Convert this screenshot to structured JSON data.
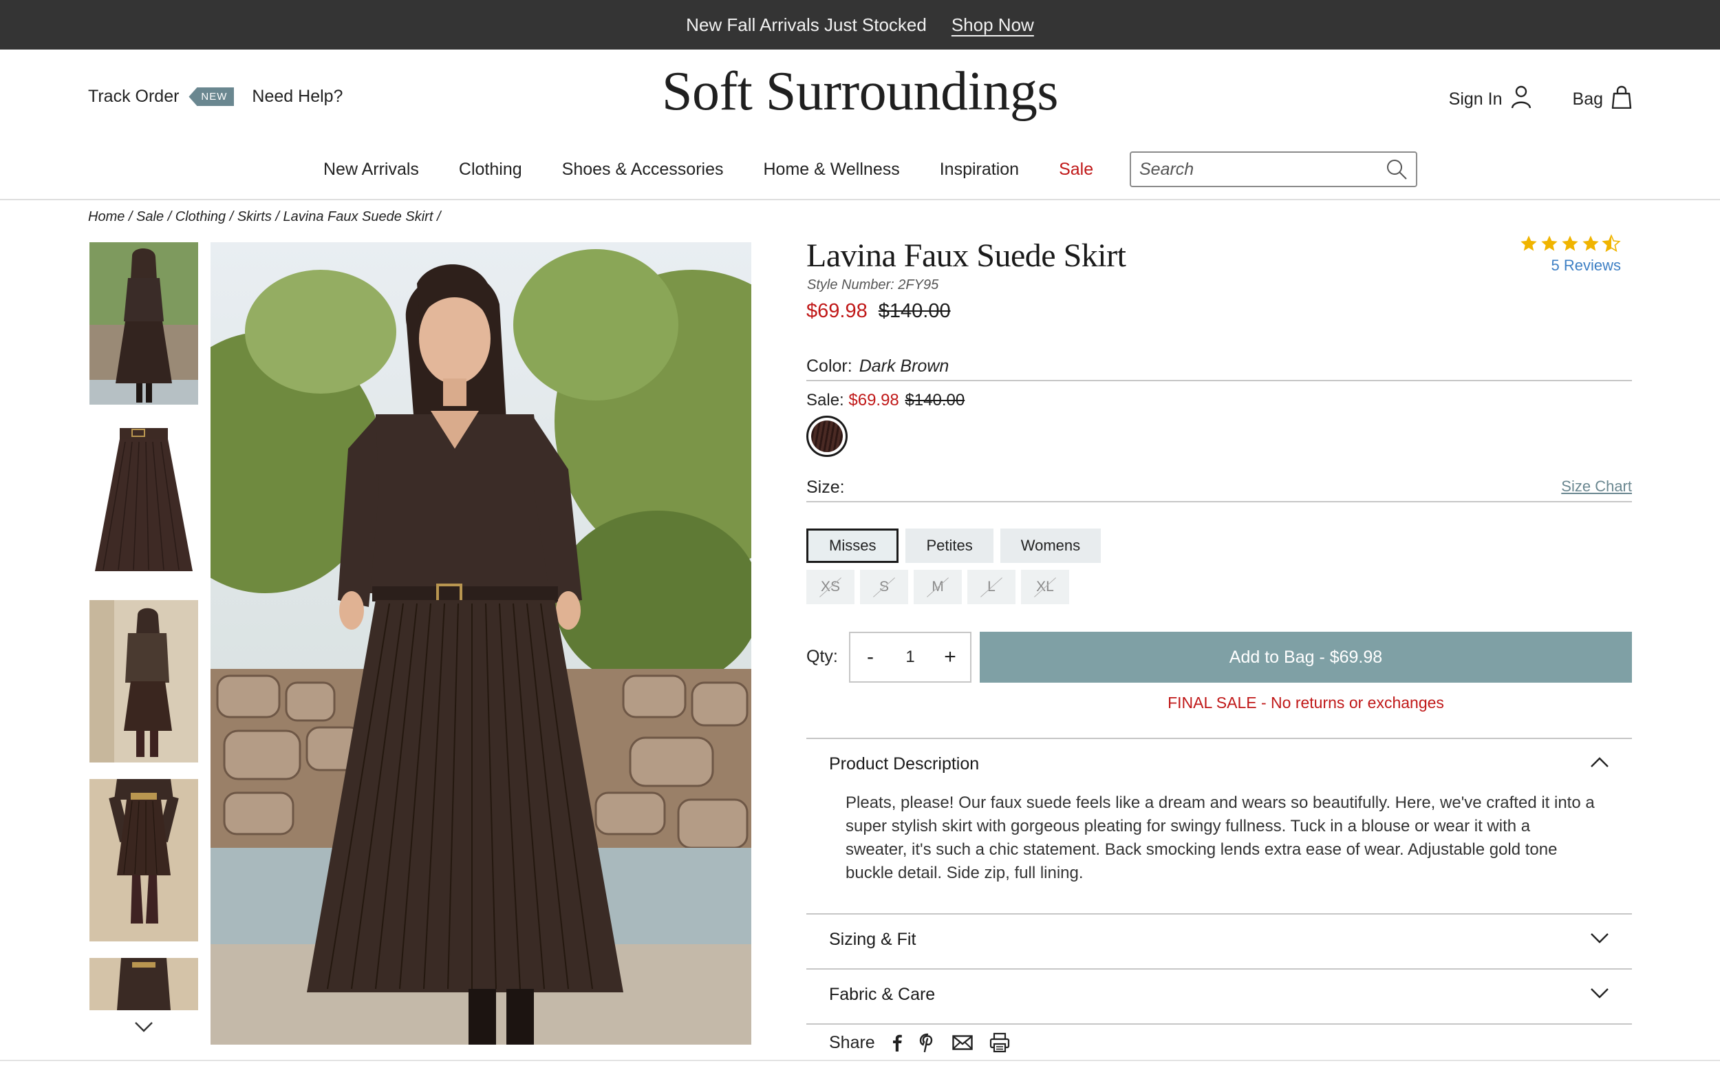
{
  "promo": {
    "text": "New Fall Arrivals Just Stocked",
    "link": "Shop Now"
  },
  "header": {
    "track_order": "Track Order",
    "new_badge": "NEW",
    "need_help": "Need Help?",
    "logo": "Soft Surroundings",
    "sign_in": "Sign In",
    "bag": "Bag"
  },
  "nav": {
    "items": [
      "New Arrivals",
      "Clothing",
      "Shoes & Accessories",
      "Home & Wellness",
      "Inspiration",
      "Sale"
    ],
    "search_placeholder": "Search"
  },
  "breadcrumb": [
    "Home /",
    "Sale /",
    "Clothing /",
    "Skirts /",
    "Lavina Faux Suede Skirt /"
  ],
  "product": {
    "title": "Lavina Faux Suede Skirt",
    "style_number": "Style Number: 2FY95",
    "sale_price": "$69.98",
    "original_price": "$140.00",
    "rating": 4.5,
    "reviews": "5 Reviews",
    "color_label": "Color:",
    "color_value": "Dark Brown",
    "sale_label": "Sale:",
    "swatch_color": "#3a201b",
    "size_label": "Size:",
    "size_chart": "Size Chart",
    "fit_options": [
      "Misses",
      "Petites",
      "Womens"
    ],
    "selected_fit": "Misses",
    "sizes": [
      "XS",
      "S",
      "M",
      "L",
      "XL"
    ],
    "qty_label": "Qty:",
    "qty_minus": "-",
    "qty_value": "1",
    "qty_plus": "+",
    "add_to_bag": "Add to Bag - $69.98",
    "final_sale": "FINAL SALE - No returns or exchanges",
    "description_title": "Product Description",
    "description": "Pleats, please! Our faux suede feels like a dream and wears so beautifully. Here, we've crafted it into a super stylish skirt with gorgeous pleating for swingy fullness. Tuck in a blouse or wear it with a sweater, it's such a chic statement. Back smocking lends extra ease of wear. Adjustable gold tone buckle detail. Side zip, full lining.",
    "sizing_fit": "Sizing & Fit",
    "fabric_care": "Fabric & Care",
    "share": "Share"
  },
  "colors": {
    "promo_bg": "#343434",
    "sale_red": "#c01818",
    "accent_teal": "#7fa0a5",
    "link_blue": "#3d7fc4",
    "star_gold": "#f0b400"
  },
  "icons": [
    "person-icon",
    "bag-icon",
    "search-icon",
    "star-icon",
    "chevron-down-icon",
    "chevron-up-icon",
    "facebook-icon",
    "pinterest-icon",
    "email-icon",
    "print-icon"
  ]
}
